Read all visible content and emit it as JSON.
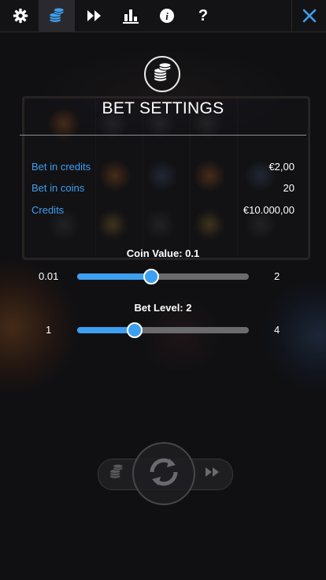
{
  "nav": {
    "items": [
      {
        "name": "settings",
        "icon": "gear-icon",
        "active": false
      },
      {
        "name": "bet-settings",
        "icon": "coin-stack-icon",
        "active": true
      },
      {
        "name": "autoplay",
        "icon": "fast-forward-icon",
        "active": false
      },
      {
        "name": "history",
        "icon": "bar-chart-icon",
        "active": false
      },
      {
        "name": "info",
        "icon": "info-icon",
        "active": false
      },
      {
        "name": "help",
        "icon": "question-icon",
        "active": false
      }
    ],
    "info_glyph": "i",
    "help_glyph": "?",
    "close_icon": "close-icon"
  },
  "panel": {
    "title": "BET SETTINGS",
    "icon": "coin-stack-icon",
    "rows": [
      {
        "label": "Bet in credits",
        "value": "€2,00"
      },
      {
        "label": "Bet in coins",
        "value": "20"
      },
      {
        "label": "Credits",
        "value": "€10.000,00"
      }
    ]
  },
  "coin_value": {
    "title": "Coin Value: 0.1",
    "min": "0.01",
    "max": "2",
    "fraction": 0.43
  },
  "bet_level": {
    "title": "Bet Level: 2",
    "min": "1",
    "max": "4",
    "fraction": 0.335
  },
  "colors": {
    "accent": "#3d9ff0",
    "close": "#3d9ff0",
    "background": "#141416",
    "track": "#6b6b6e"
  },
  "bottom": {
    "left_icon": "coin-stack-icon",
    "spin_icon": "refresh-icon",
    "right_icon": "fast-forward-icon"
  }
}
